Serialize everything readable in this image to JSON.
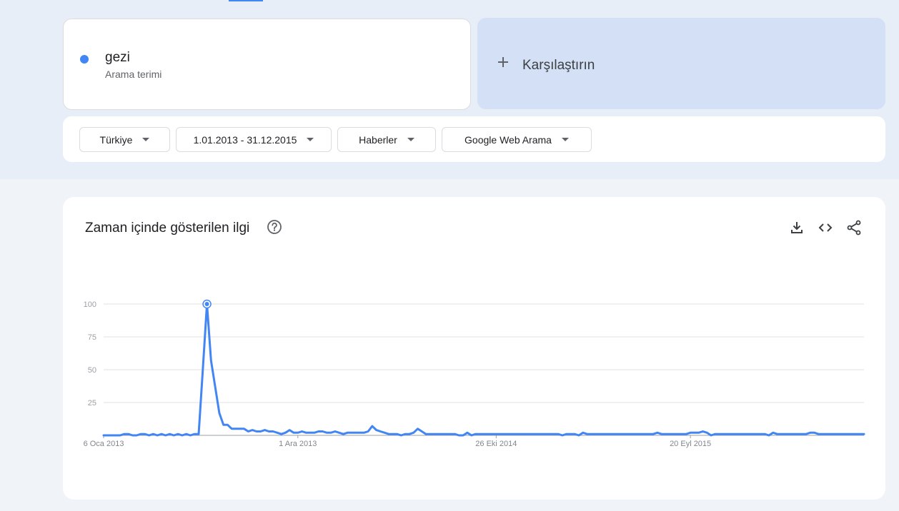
{
  "search_term": {
    "name": "gezi",
    "type": "Arama terimi",
    "color": "#4285f4"
  },
  "compare": {
    "label": "Karşılaştırın",
    "icon": "plus-icon"
  },
  "filters": {
    "region": "Türkiye",
    "date_range": "1.01.2013 - 31.12.2015",
    "category": "Haberler",
    "search_type": "Google Web Arama"
  },
  "chart_section": {
    "title": "Zaman içinde gösterilen ilgi",
    "help_icon": "help-circle-icon",
    "actions": [
      "download-icon",
      "embed-code-icon",
      "share-icon"
    ]
  },
  "chart_data": {
    "type": "line",
    "ylim": [
      0,
      100
    ],
    "y_ticks": [
      "100",
      "75",
      "50",
      "25"
    ],
    "x_tick_labels": [
      "6 Oca 2013",
      "1 Ara 2013",
      "26 Eki 2014",
      "20 Eyl 2015"
    ],
    "grid": true,
    "series": [
      {
        "color": "#4285f4",
        "values": [
          0,
          0,
          0,
          0,
          0,
          1,
          1,
          0,
          0,
          1,
          1,
          0,
          1,
          0,
          1,
          0,
          1,
          0,
          1,
          0,
          1,
          0,
          1,
          1,
          50,
          100,
          57,
          37,
          17,
          8,
          8,
          5,
          5,
          5,
          5,
          3,
          4,
          3,
          3,
          4,
          3,
          3,
          2,
          1,
          2,
          4,
          2,
          2,
          3,
          2,
          2,
          2,
          3,
          3,
          2,
          2,
          3,
          2,
          1,
          2,
          2,
          2,
          2,
          2,
          3,
          7,
          4,
          3,
          2,
          1,
          1,
          1,
          0,
          1,
          1,
          2,
          5,
          3,
          1,
          1,
          1,
          1,
          1,
          1,
          1,
          1,
          0,
          0,
          2,
          0,
          1,
          1,
          1,
          1,
          1,
          1,
          1,
          1,
          1,
          1,
          1,
          1,
          1,
          1,
          1,
          1,
          1,
          1,
          1,
          1,
          1,
          0,
          1,
          1,
          1,
          0,
          2,
          1,
          1,
          1,
          1,
          1,
          1,
          1,
          1,
          1,
          1,
          1,
          1,
          1,
          1,
          1,
          1,
          1,
          2,
          1,
          1,
          1,
          1,
          1,
          1,
          1,
          2,
          2,
          2,
          3,
          2,
          0,
          1,
          1,
          1,
          1,
          1,
          1,
          1,
          1,
          1,
          1,
          1,
          1,
          1,
          0,
          2,
          1,
          1,
          1,
          1,
          1,
          1,
          1,
          1,
          2,
          2,
          1,
          1,
          1,
          1,
          1,
          1,
          1,
          1,
          1,
          1,
          1,
          1
        ],
        "peak_marker_index": 25
      }
    ]
  }
}
